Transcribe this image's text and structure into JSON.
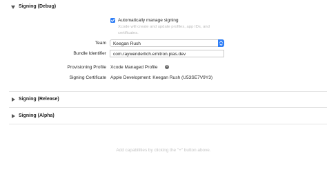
{
  "sections": {
    "debug": {
      "title": "Signing (Debug)",
      "expanded": true
    },
    "release": {
      "title": "Signing (Release)",
      "expanded": false
    },
    "alpha": {
      "title": "Signing (Alpha)",
      "expanded": false
    }
  },
  "debug": {
    "auto_manage": {
      "checked": true,
      "label": "Automatically manage signing",
      "description": "Xcode will create and update profiles, app IDs, and certificates."
    },
    "team": {
      "label": "Team",
      "value": "Keegan Rush"
    },
    "bundle_identifier": {
      "label": "Bundle Identifier",
      "value": "com.raywenderlich.emitron.pias.dev"
    },
    "provisioning_profile": {
      "label": "Provisioning Profile",
      "value": "Xcode Managed Profile",
      "info_icon": "i"
    },
    "signing_certificate": {
      "label": "Signing Certificate",
      "value": "Apple Development: Keegan Rush (U53SE7V9Y3)"
    }
  },
  "footer_hint": "Add capabilities by clicking the \"+\" button above.",
  "colors": {
    "accent": "#2f7ef6",
    "hint_text": "#c4c4c4",
    "divider": "#e3e3e3"
  },
  "icons": {
    "expanded": "disclosure-down-icon",
    "collapsed": "disclosure-right-icon",
    "checkbox": "checkmark-icon",
    "popup": "chevron-updown-icon"
  }
}
